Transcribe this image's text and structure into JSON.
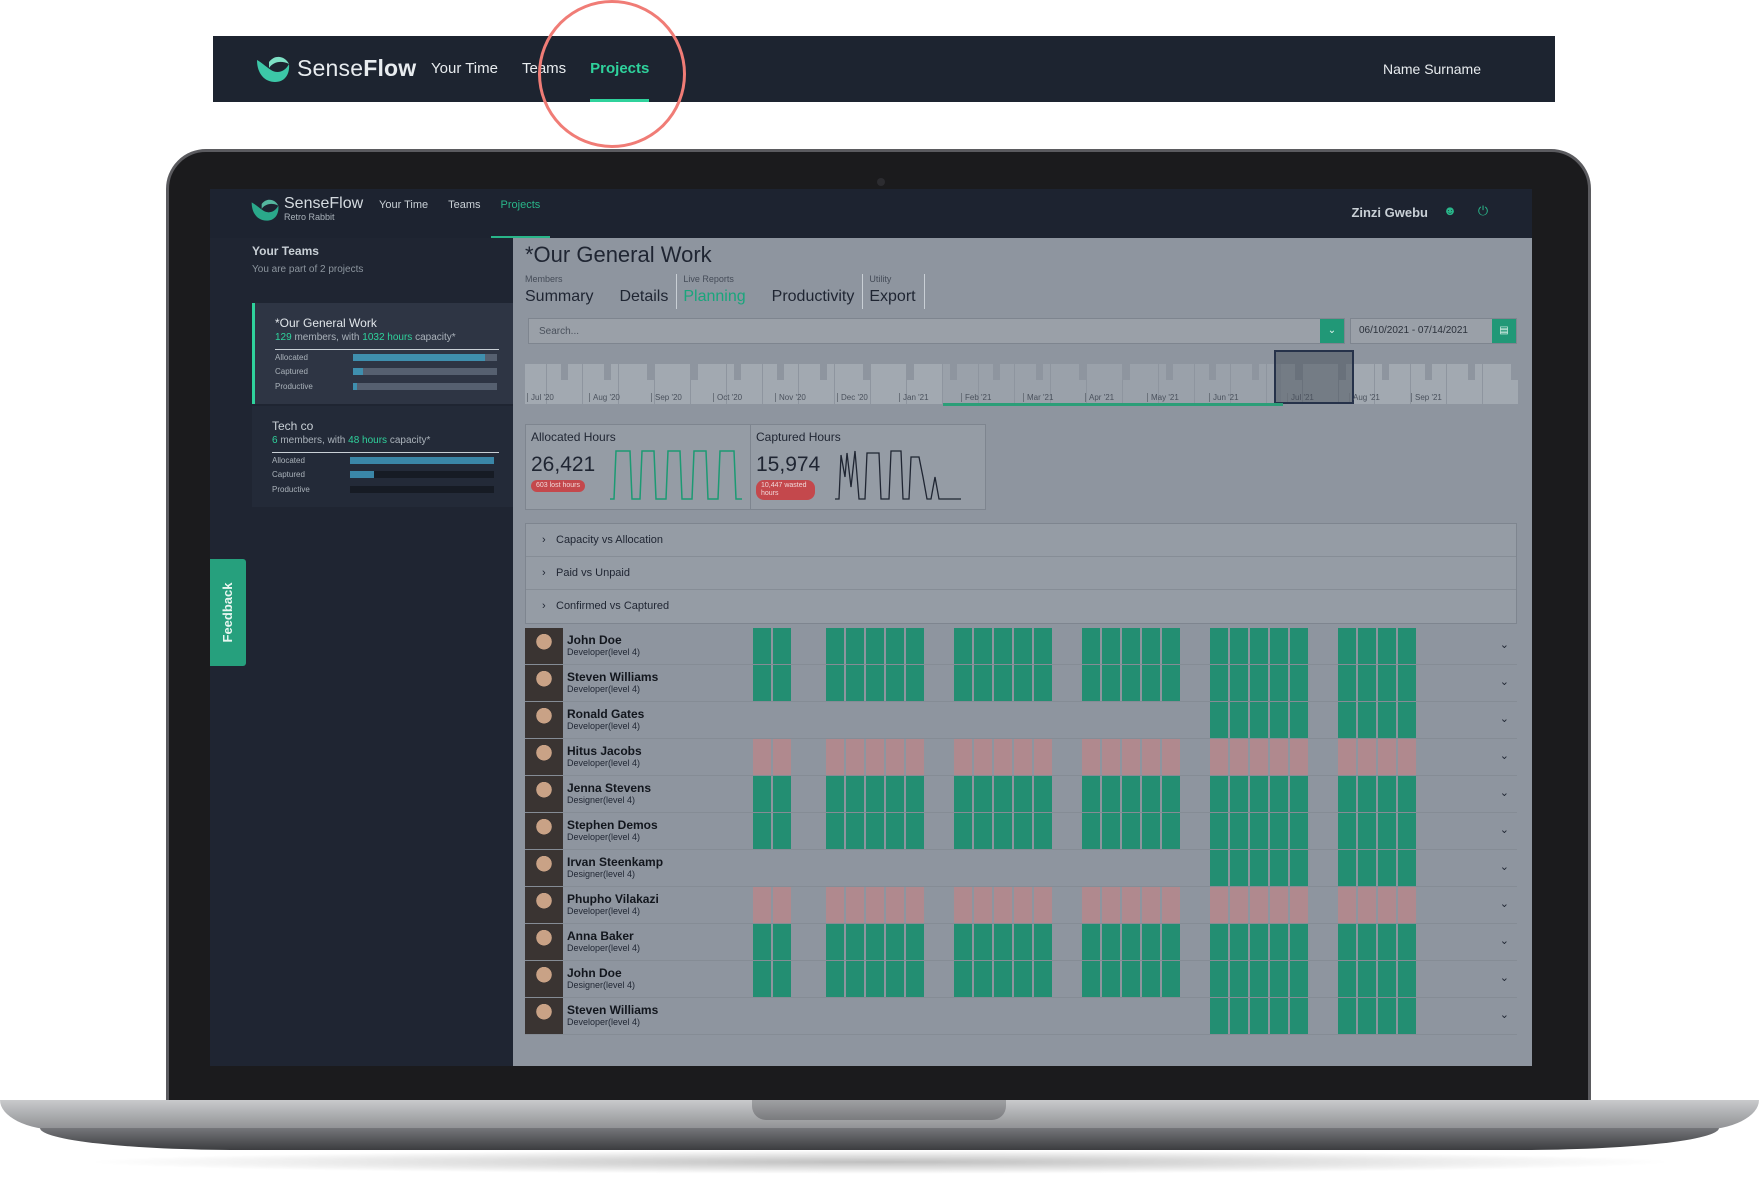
{
  "top_nav": {
    "brand_light": "Sense",
    "brand_bold": "Flow",
    "items": [
      "Your Time",
      "Teams",
      "Projects"
    ],
    "active": "Projects",
    "user": "Name Surname"
  },
  "app": {
    "brand": "SenseFlow",
    "brand_sub": "Retro Rabbit",
    "nav": [
      "Your Time",
      "Teams",
      "Projects"
    ],
    "active": "Projects",
    "user": "Zinzi Gwebu",
    "icons": [
      "user-icon",
      "power-icon"
    ]
  },
  "sidebar": {
    "title": "Your Teams",
    "subtitle": "You are part of 2 projects",
    "feedback": "Feedback",
    "teams": [
      {
        "name": "*Our General Work",
        "members": "129",
        "members_text": " members, with ",
        "hours": "1032 hours",
        "capacity_text": " capacity*",
        "bars": [
          {
            "label": "Allocated",
            "fill": 0.92
          },
          {
            "label": "Captured",
            "fill": 0.07
          },
          {
            "label": "Productive",
            "fill": 0.03
          }
        ]
      },
      {
        "name": "Tech co",
        "members": "6",
        "members_text": " members, with ",
        "hours": "48 hours",
        "capacity_text": " capacity*",
        "bars": [
          {
            "label": "Allocated",
            "fill": 1.0
          },
          {
            "label": "Captured",
            "fill": 0.17
          },
          {
            "label": "Productive",
            "fill": 0.0
          }
        ]
      }
    ]
  },
  "main": {
    "title": "*Our General Work",
    "tab_groups": [
      {
        "group": "Members",
        "tabs": [
          "Summary",
          "Details"
        ]
      },
      {
        "group": "Live Reports",
        "tabs": [
          "Planning",
          "Productivity"
        ]
      },
      {
        "group": "Utility",
        "tabs": [
          "Export"
        ]
      }
    ],
    "active_tab": "Planning",
    "search_placeholder": "Search...",
    "date_range": "06/10/2021 - 07/14/2021",
    "months": [
      "Jul '20",
      "Aug '20",
      "Sep '20",
      "Oct '20",
      "Nov '20",
      "Dec '20",
      "Jan '21",
      "Feb '21",
      "Mar '21",
      "Apr '21",
      "May '21",
      "Jun '21",
      "Jul '21",
      "Aug '21",
      "Sep '21"
    ],
    "stats": [
      {
        "label": "Allocated Hours",
        "value": "26,421",
        "pill": "603 lost hours"
      },
      {
        "label": "Captured Hours",
        "value": "15,974",
        "pill_line1": "10,447 wasted",
        "pill_line2": "hours"
      }
    ],
    "accordion": [
      "Capacity vs Allocation",
      "Paid vs Unpaid",
      "Confirmed vs Captured"
    ],
    "people": [
      {
        "name": "John Doe",
        "role": "Developer(level 4)",
        "status": "g",
        "full": true
      },
      {
        "name": "Steven Williams",
        "role": "Developer(level 4)",
        "status": "g",
        "full": true
      },
      {
        "name": "Ronald Gates",
        "role": "Developer(level 4)",
        "status": "g",
        "full": false
      },
      {
        "name": "Hitus Jacobs",
        "role": "Developer(level 4)",
        "status": "r",
        "full": true
      },
      {
        "name": "Jenna Stevens",
        "role": "Designer(level 4)",
        "status": "g",
        "full": true
      },
      {
        "name": "Stephen Demos",
        "role": "Developer(level 4)",
        "status": "g",
        "full": true
      },
      {
        "name": "Irvan Steenkamp",
        "role": "Designer(level 4)",
        "status": "g",
        "full": false
      },
      {
        "name": "Phupho Vilakazi",
        "role": "Developer(level 4)",
        "status": "r",
        "full": true
      },
      {
        "name": "Anna Baker",
        "role": "Developer(level 4)",
        "status": "g",
        "full": true
      },
      {
        "name": "John Doe",
        "role": "Designer(level 4)",
        "status": "g",
        "full": true
      },
      {
        "name": "Steven Williams",
        "role": "Developer(level 4)",
        "status": "g",
        "full": false
      }
    ]
  },
  "colors": {
    "accent": "#2fd29c",
    "dark": "#1d2430",
    "highlight_ring": "#f07c76",
    "cell_green": "#238e72",
    "cell_red": "#b0898e"
  }
}
